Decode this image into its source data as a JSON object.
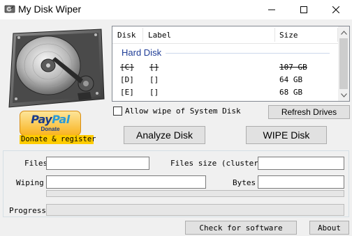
{
  "window": {
    "title": "My Disk Wiper",
    "icon": "disk-drive-icon",
    "controls": [
      "minimize",
      "maximize",
      "close"
    ]
  },
  "donate": {
    "paypal_logo_pay": "Pay",
    "paypal_logo_pal": "Pal",
    "paypal_donate": "Donate",
    "link_text": "Donate & register"
  },
  "drive_list": {
    "columns": [
      "Disk",
      "Label",
      "Size"
    ],
    "group": "Hard Disk",
    "rows": [
      {
        "disk": "[C]",
        "label": "[]",
        "size": "107 GB",
        "disabled": true
      },
      {
        "disk": "[D]",
        "label": "[]",
        "size": "64 GB",
        "disabled": false
      },
      {
        "disk": "[E]",
        "label": "[]",
        "size": "68 GB",
        "disabled": false
      }
    ]
  },
  "options": {
    "allow_system_wipe_label": "Allow wipe of System Disk",
    "allow_system_wipe_checked": false
  },
  "buttons": {
    "refresh": "Refresh Drives",
    "analyze": "Analyze Disk",
    "wipe": "WIPE Disk",
    "check": "Check for software",
    "about": "About"
  },
  "status": {
    "files_label": "Files",
    "files_value": "",
    "files_size_label": "Files size (cluster,",
    "files_size_value": "",
    "wiping_label": "Wiping",
    "wiping_value": "",
    "bytes_label": "Bytes",
    "bytes_value": "",
    "wiping_progress": 0,
    "progress_label": "Progress",
    "progress": 0
  },
  "colors": {
    "group_header": "#1e3c96",
    "donate_highlight": "#ffcc00",
    "paypal_gold": "#f9b421"
  }
}
